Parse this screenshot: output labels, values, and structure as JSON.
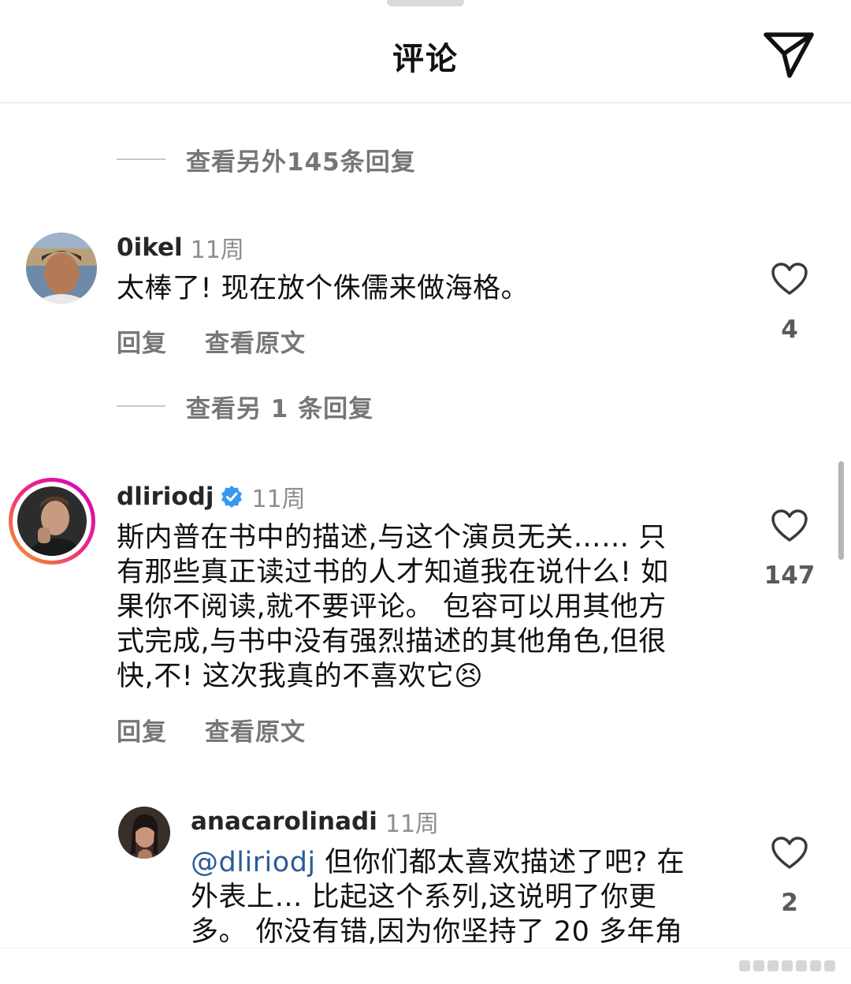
{
  "header": {
    "title": "评论",
    "send_icon": "paper-plane-icon"
  },
  "thread": {
    "view_more_replies_1": "查看另外145条回复",
    "view_more_replies_2": "查看另 1 条回复"
  },
  "comments": [
    {
      "username": "0ikel",
      "time": "11周",
      "text": "太棒了! 现在放个侏儒来做海格。",
      "likes": "4",
      "reply_label": "回复",
      "translate_label": "查看原文"
    },
    {
      "username": "dliriodj",
      "verified": true,
      "time": "11周",
      "lines": [
        "斯内普在书中的描述,与这个演员无关…… 只",
        "有那些真正读过书的人才知道我在说什么! 如",
        "果你不阅读,就不要评论。 包容可以用其他方",
        "式完成,与书中没有强烈描述的其他角色,但很",
        "快,不! 这次我真的不喜欢它"
      ],
      "emoji": "😣",
      "likes": "147",
      "reply_label": "回复",
      "translate_label": "查看原文"
    },
    {
      "username": "anacarolinadi",
      "time": "11周",
      "mention": "@dliriodj",
      "lines": [
        " 但你们都太喜欢描述了吧? 在",
        "外表上… 比起这个系列,这说明了你更",
        "多。 你没有错,因为你坚持了 20 多年角"
      ],
      "likes": "2"
    }
  ],
  "colors": {
    "text": "#111111",
    "secondary": "#767676",
    "mention": "#2b5c97",
    "verified": "#3897f0",
    "story_ring_start": "#f5a623",
    "story_ring_end": "#d300c5"
  }
}
